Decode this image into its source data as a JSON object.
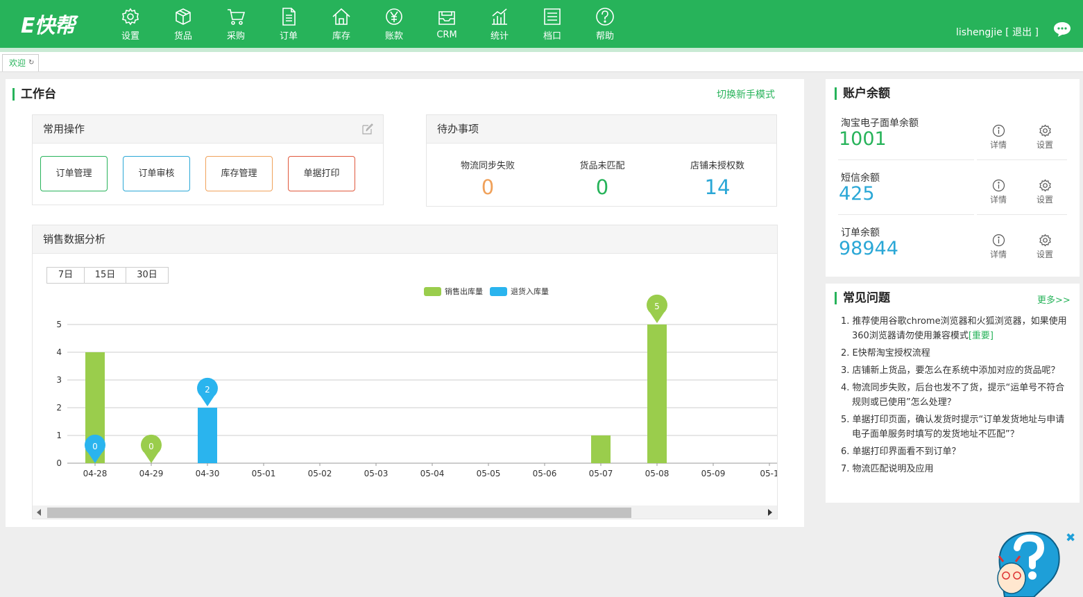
{
  "header": {
    "logo": "E快帮",
    "nav": [
      {
        "label": "设置",
        "icon": "gear-icon"
      },
      {
        "label": "货品",
        "icon": "box-icon"
      },
      {
        "label": "采购",
        "icon": "cart-icon"
      },
      {
        "label": "订单",
        "icon": "document-icon"
      },
      {
        "label": "库存",
        "icon": "home-icon"
      },
      {
        "label": "账款",
        "icon": "yen-icon"
      },
      {
        "label": "CRM",
        "icon": "inbox-icon"
      },
      {
        "label": "统计",
        "icon": "chart-icon"
      },
      {
        "label": "档口",
        "icon": "list-icon"
      },
      {
        "label": "帮助",
        "icon": "help-icon"
      }
    ],
    "username": "lishengjie",
    "logout": "[ 退出 ]",
    "brand_color": "#27b35a"
  },
  "tabs": [
    {
      "label": "欢迎"
    }
  ],
  "workbench": {
    "title": "工作台",
    "switch_mode": "切换新手模式",
    "common_ops": {
      "title": "常用操作",
      "buttons": [
        {
          "label": "订单管理",
          "color": "#27b35a"
        },
        {
          "label": "订单审核",
          "color": "#2aa7d6"
        },
        {
          "label": "库存管理",
          "color": "#f0a15a"
        },
        {
          "label": "单据打印",
          "color": "#e0573b"
        }
      ]
    },
    "todo": {
      "title": "待办事项",
      "items": [
        {
          "label": "物流同步失败",
          "value": "0",
          "color": "#f0a15a"
        },
        {
          "label": "货品未匹配",
          "value": "0",
          "color": "#27b35a"
        },
        {
          "label": "店铺未授权数",
          "value": "14",
          "color": "#2aa7d6"
        }
      ]
    },
    "sales": {
      "title": "销售数据分析",
      "periods": [
        "7日",
        "15日",
        "30日"
      ]
    }
  },
  "chart_data": {
    "type": "bar",
    "categories": [
      "04-28",
      "04-29",
      "04-30",
      "05-01",
      "05-02",
      "05-03",
      "05-04",
      "05-05",
      "05-06",
      "05-07",
      "05-08",
      "05-09",
      "05-1"
    ],
    "series": [
      {
        "name": "销售出库量",
        "color": "#9acd4c",
        "values": [
          4,
          0,
          0,
          0,
          0,
          0,
          0,
          0,
          0,
          1,
          5,
          0,
          0
        ]
      },
      {
        "name": "退货入库量",
        "color": "#2ab4ee",
        "values": [
          0,
          0,
          2,
          0,
          0,
          0,
          0,
          0,
          0,
          0,
          0,
          0,
          0
        ]
      }
    ],
    "yticks": [
      "0",
      "1",
      "2",
      "3",
      "4",
      "5"
    ],
    "ylim": [
      0,
      5
    ],
    "markers": [
      {
        "series": 1,
        "index": 0,
        "label": "0"
      },
      {
        "series": 0,
        "index": 1,
        "label": "0"
      },
      {
        "series": 1,
        "index": 2,
        "label": "2"
      },
      {
        "series": 0,
        "index": 10,
        "label": "5"
      }
    ],
    "legend_position": "top-center",
    "grid": true
  },
  "balance": {
    "title": "账户余额",
    "items": [
      {
        "label": "淘宝电子面单余额",
        "value": "1001",
        "color": "#27b35a"
      },
      {
        "label": "短信余额",
        "value": "425",
        "color": "#2aa7d6"
      },
      {
        "label": "订单余额",
        "value": "98944",
        "color": "#2aa7d6"
      }
    ],
    "detail_label": "详情",
    "settings_label": "设置"
  },
  "faq": {
    "title": "常见问题",
    "more": "更多>>",
    "items": [
      {
        "text": "1. 推荐使用谷歌chrome浏览器和火狐浏览器，如果使用360浏览器请勿使用兼容模式",
        "tag": "[重要]"
      },
      {
        "text": "2. E快帮淘宝授权流程",
        "tag": ""
      },
      {
        "text": "3. 店铺新上货品，要怎么在系统中添加对应的货品呢？",
        "tag": ""
      },
      {
        "text": "4. 物流同步失败，后台也发不了货，提示“运单号不符合规则或已使用”怎么处理？",
        "tag": ""
      },
      {
        "text": "5. 单据打印页面，确认发货时提示“订单发货地址与申请电子面单服务时填写的发货地址不匹配”？",
        "tag": ""
      },
      {
        "text": "6. 单据打印界面看不到订单？",
        "tag": ""
      },
      {
        "text": "7. 物流匹配说明及应用",
        "tag": ""
      }
    ]
  }
}
